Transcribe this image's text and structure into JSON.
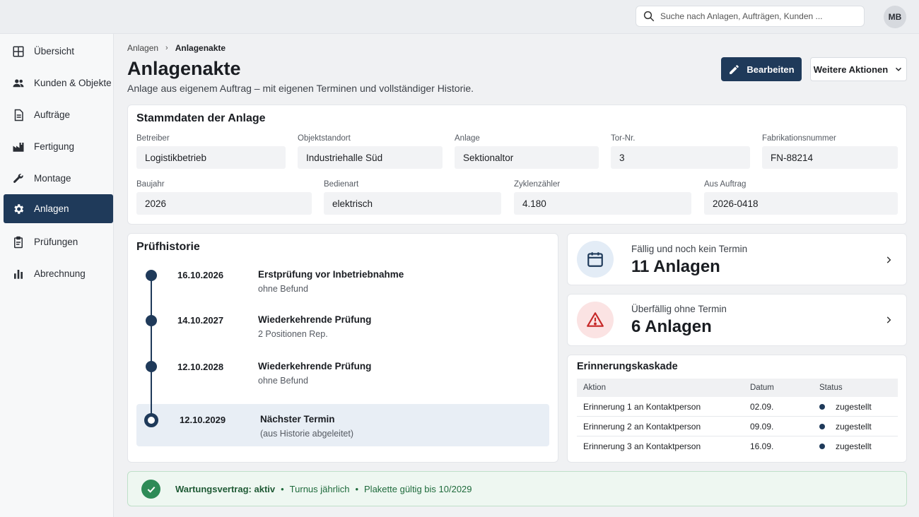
{
  "search": {
    "placeholder": "Suche nach Anlagen, Aufträgen, Kunden ..."
  },
  "user": {
    "initials": "MB"
  },
  "sidebar": {
    "items": [
      {
        "label": "Übersicht",
        "icon": "grid-icon"
      },
      {
        "label": "Kunden & Objekte",
        "icon": "users-icon"
      },
      {
        "label": "Aufträge",
        "icon": "document-icon"
      },
      {
        "label": "Fertigung",
        "icon": "factory-icon"
      },
      {
        "label": "Montage",
        "icon": "wrench-icon"
      },
      {
        "label": "Anlagen",
        "icon": "gear-icon",
        "active": true
      },
      {
        "label": "Prüfungen",
        "icon": "clipboard-icon"
      },
      {
        "label": "Abrechnung",
        "icon": "bar-chart-icon"
      }
    ]
  },
  "breadcrumb": {
    "parent": "Anlagen",
    "current": "Anlagenakte"
  },
  "header": {
    "title": "Anlagenakte",
    "subtitle": "Anlage aus eigenem Auftrag – mit eigenen Terminen und vollständiger Historie.",
    "edit_label": "Bearbeiten",
    "more_label": "Weitere Aktionen"
  },
  "stammdaten": {
    "title": "Stammdaten der Anlage",
    "fields": [
      {
        "label": "Betreiber",
        "value": "Logistikbetrieb"
      },
      {
        "label": "Objektstandort",
        "value": "Industriehalle Süd"
      },
      {
        "label": "Anlage",
        "value": "Sektionaltor"
      },
      {
        "label": "Tor-Nr.",
        "value": "3"
      },
      {
        "label": "Fabrikationsnummer",
        "value": "FN-88214"
      },
      {
        "label": "Baujahr",
        "value": "2026"
      },
      {
        "label": "Bedienart",
        "value": "elektrisch"
      },
      {
        "label": "Zyklenzähler",
        "value": "4.180"
      },
      {
        "label": "Aus Auftrag",
        "value": "2026-0418"
      }
    ]
  },
  "pruefhistorie": {
    "title": "Prüfhistorie",
    "entries": [
      {
        "date": "16.10.2026",
        "title": "Erstprüfung vor Inbetriebnahme",
        "sub": "ohne Befund"
      },
      {
        "date": "14.10.2027",
        "title": "Wiederkehrende Prüfung",
        "sub": "2 Positionen Rep."
      },
      {
        "date": "12.10.2028",
        "title": "Wiederkehrende Prüfung",
        "sub": "ohne Befund"
      },
      {
        "date": "12.10.2029",
        "title": "Nächster Termin",
        "sub": "(aus Historie abgeleitet)"
      }
    ]
  },
  "stats": [
    {
      "label": "Fällig und noch kein Termin",
      "value": "11 Anlagen",
      "icon": "calendar-icon",
      "color": "#1f3a5a",
      "bg": "#e3ecf6"
    },
    {
      "label": "Überfällig ohne Termin",
      "value": "6 Anlagen",
      "icon": "warning-icon",
      "color": "#c62828",
      "bg": "#fbe3e3"
    }
  ],
  "erinnerung": {
    "title": "Erinnerungskaskade",
    "columns": [
      "Aktion",
      "Datum",
      "Status"
    ],
    "rows": [
      {
        "aktion": "Erinnerung 1 an Kontaktperson",
        "datum": "02.09.",
        "status": "zugestellt"
      },
      {
        "aktion": "Erinnerung 2 an Kontaktperson",
        "datum": "09.09.",
        "status": "zugestellt"
      },
      {
        "aktion": "Erinnerung 3 an Kontaktperson",
        "datum": "16.09.",
        "status": "zugestellt"
      }
    ]
  },
  "footer": {
    "contract": "Wartungsvertrag: aktiv",
    "turnus": "Turnus jährlich",
    "plakette": "Plakette gültig bis 10/2029"
  },
  "colors": {
    "primary": "#1f3a5a",
    "success": "#2e8b57",
    "danger": "#c62828"
  }
}
